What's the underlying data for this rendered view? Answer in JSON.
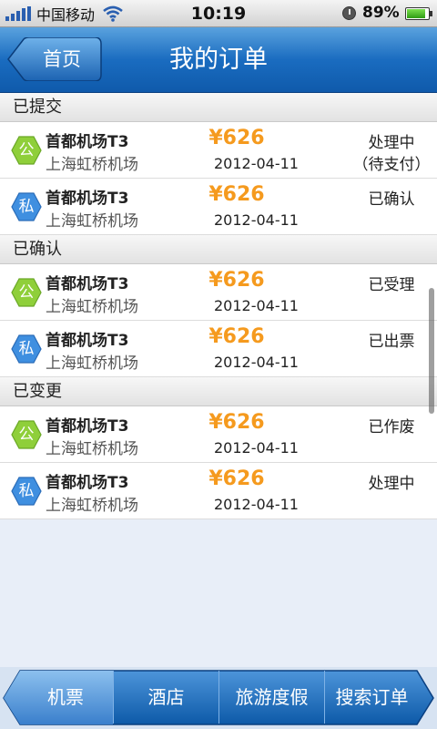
{
  "status_bar": {
    "carrier": "中国移动",
    "time": "10:19",
    "battery": "89%",
    "battery_level": 0.89
  },
  "nav": {
    "back_label": "首页",
    "title": "我的订单"
  },
  "sections": [
    {
      "title": "已提交",
      "orders": [
        {
          "type": "公",
          "type_color": "green",
          "from": "首都机场T3",
          "to": "上海虹桥机场",
          "price": "¥626",
          "date": "2012-04-11",
          "status": "处理中",
          "substatus": "（待支付）"
        },
        {
          "type": "私",
          "type_color": "blue",
          "from": "首都机场T3",
          "to": "上海虹桥机场",
          "price": "¥626",
          "date": "2012-04-11",
          "status": "已确认",
          "substatus": ""
        }
      ]
    },
    {
      "title": "已确认",
      "orders": [
        {
          "type": "公",
          "type_color": "green",
          "from": "首都机场T3",
          "to": "上海虹桥机场",
          "price": "¥626",
          "date": "2012-04-11",
          "status": "已受理",
          "substatus": ""
        },
        {
          "type": "私",
          "type_color": "blue",
          "from": "首都机场T3",
          "to": "上海虹桥机场",
          "price": "¥626",
          "date": "2012-04-11",
          "status": "已出票",
          "substatus": ""
        }
      ]
    },
    {
      "title": "已变更",
      "orders": [
        {
          "type": "公",
          "type_color": "green",
          "from": "首都机场T3",
          "to": "上海虹桥机场",
          "price": "¥626",
          "date": "2012-04-11",
          "status": "已作废",
          "substatus": ""
        },
        {
          "type": "私",
          "type_color": "blue",
          "from": "首都机场T3",
          "to": "上海虹桥机场",
          "price": "¥626",
          "date": "2012-04-11",
          "status": "处理中",
          "substatus": ""
        }
      ]
    }
  ],
  "tabs": [
    {
      "label": "机票",
      "active": true
    },
    {
      "label": "酒店",
      "active": false
    },
    {
      "label": "旅游度假",
      "active": false
    },
    {
      "label": "搜索订单",
      "active": false
    }
  ],
  "colors": {
    "accent": "#1a6cc0",
    "price": "#f59a1e",
    "badge_green": "#8fcf3a",
    "badge_blue": "#3f8fe0"
  }
}
